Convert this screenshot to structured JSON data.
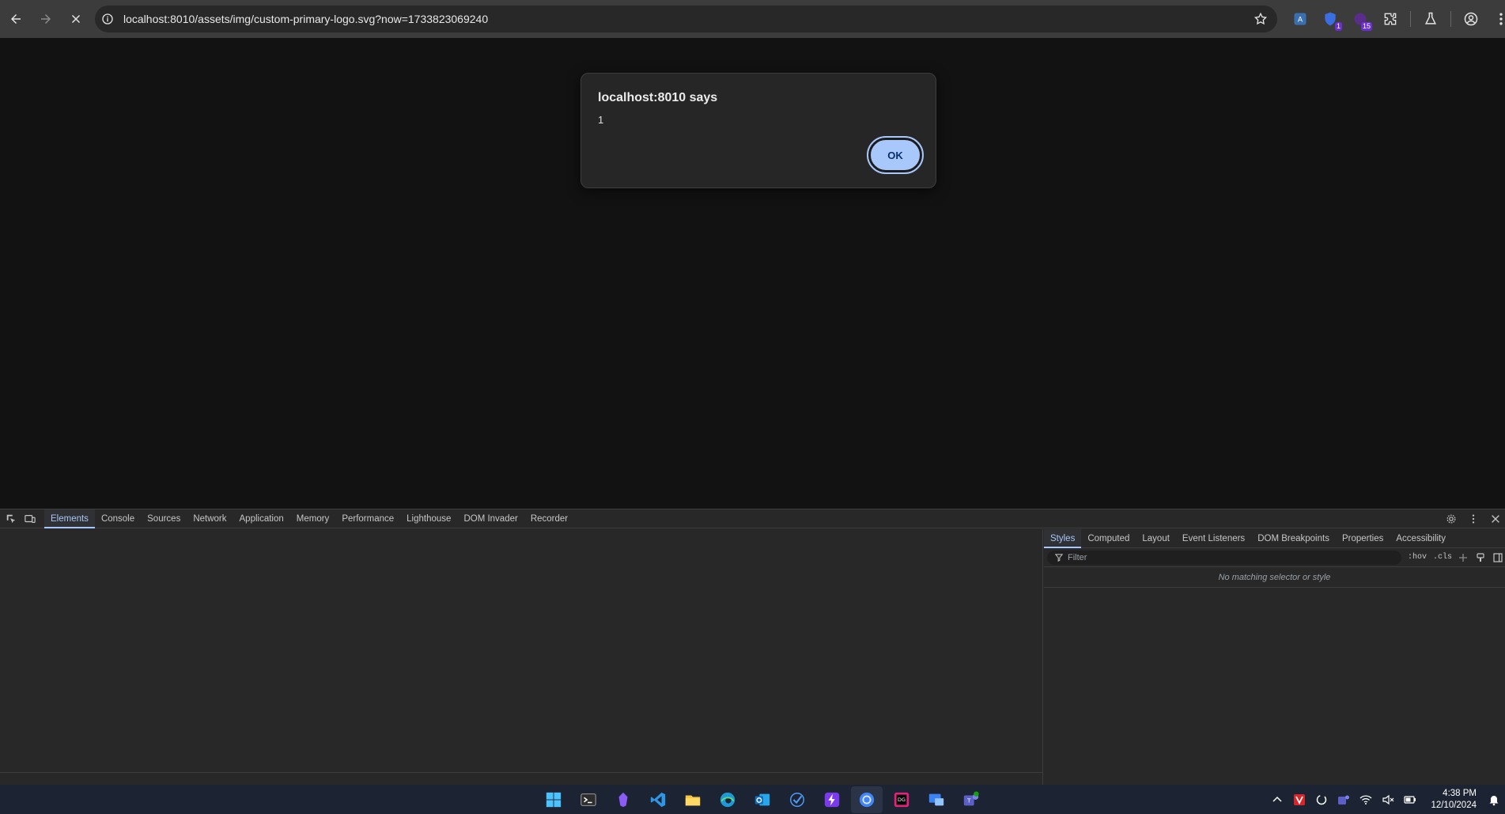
{
  "browser": {
    "url": "localhost:8010/assets/img/custom-primary-logo.svg?now=1733823069240",
    "extensions": [
      {
        "icon": "translate-extension-icon",
        "badge": ""
      },
      {
        "icon": "shield-extension-icon",
        "badge": "1"
      },
      {
        "icon": "counter-extension-icon",
        "badge": "15"
      }
    ]
  },
  "dialog": {
    "title": "localhost:8010 says",
    "message": "1",
    "ok_label": "OK"
  },
  "devtools": {
    "tabs": [
      "Elements",
      "Console",
      "Sources",
      "Network",
      "Application",
      "Memory",
      "Performance",
      "Lighthouse",
      "DOM Invader",
      "Recorder"
    ],
    "active_tab": "Elements",
    "styles_tabs": [
      "Styles",
      "Computed",
      "Layout",
      "Event Listeners",
      "DOM Breakpoints",
      "Properties",
      "Accessibility"
    ],
    "active_styles_tab": "Styles",
    "filter_placeholder": "Filter",
    "hov_label": ":hov",
    "cls_label": ".cls",
    "no_match_text": "No matching selector or style"
  },
  "taskbar": {
    "apps": [
      "windows-start-icon",
      "terminal-icon",
      "obsidian-icon",
      "vscode-icon",
      "file-explorer-icon",
      "edge-icon",
      "outlook-icon",
      "todo-icon",
      "bolt-app-icon",
      "chrome-icon",
      "datagrip-icon",
      "remote-desktop-icon",
      "teams-icon"
    ],
    "time": "4:38 PM",
    "date": "12/10/2024"
  },
  "colors": {
    "accent": "#a8c7fa",
    "toolbar_bg": "#3c3c3c",
    "page_bg": "#121212",
    "devtools_bg": "#282828",
    "taskbar_bg": "#1c2433"
  }
}
